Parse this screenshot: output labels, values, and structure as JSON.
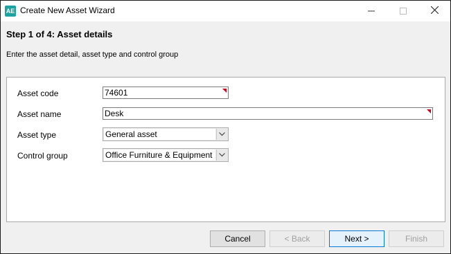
{
  "window": {
    "app_icon": "AE",
    "title": "Create New Asset Wizard"
  },
  "header": {
    "step_title": "Step 1 of 4: Asset details",
    "step_description": "Enter the asset detail, asset type and control group"
  },
  "form": {
    "asset_code": {
      "label": "Asset code",
      "value": "74601"
    },
    "asset_name": {
      "label": "Asset name",
      "value": "Desk"
    },
    "asset_type": {
      "label": "Asset type",
      "value": "General asset"
    },
    "control_group": {
      "label": "Control group",
      "value": "Office Furniture & Equipment"
    }
  },
  "buttons": {
    "cancel": "Cancel",
    "back": "< Back",
    "next": "Next >",
    "finish": "Finish"
  },
  "colors": {
    "required_marker": "#d0021b",
    "app_icon": "#1aa3a0",
    "default_button_border": "#0078d7"
  }
}
